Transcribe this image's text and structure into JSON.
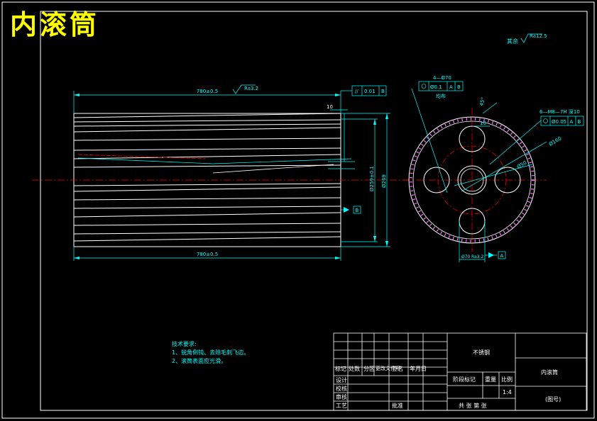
{
  "drawing": {
    "title": "内滚筒",
    "roughness_all": "其余",
    "roughness_all_value": "Ra12.5"
  },
  "front_view": {
    "overall_length_top": "780±0.5",
    "overall_length_bottom": "780±0.5",
    "roughness_top": "Ra3.2",
    "flatness_symbol": "//",
    "flatness_value": "0.01",
    "flatness_datum": "B",
    "dim_10": "10",
    "dim_15": "15",
    "dia_inner": "Ø259±0.1",
    "dia_outer": "Ø269",
    "datum_label": "B"
  },
  "side_view": {
    "holes_callout": "4—Ø70",
    "holes_tol": "Ø0.1",
    "holes_datum_a": "A",
    "holes_datum_b": "B",
    "holes_note": "均布",
    "slots_callout": "6—M8—7H 深10",
    "slots_tol": "Ø0.05",
    "slots_datum_a": "A",
    "slots_datum_b": "B",
    "pcd": "Ø160",
    "bore": "Ø50",
    "dim_45": "45°",
    "dim_10": "10",
    "bottom_dim": "Ø70",
    "bottom_roughness": "Ra3.2",
    "datum_label": "A"
  },
  "notes": {
    "heading": "技术要求:",
    "items": [
      "1、锐角倒钝、去除毛刺飞边。",
      "2、滚筒表面应光滑。"
    ]
  },
  "title_block": {
    "material": "不锈钢",
    "part_name": "内滚筒",
    "row_labels": [
      "标记",
      "处数",
      "分区",
      "更改文件号",
      "签名",
      "年月日"
    ],
    "design": "设计",
    "check": "校核",
    "review": "审核",
    "process": "工艺",
    "approve": "批准",
    "stage_mark": "阶段标记",
    "weight": "重量",
    "scale": "比例",
    "scale_value": "1:4",
    "sheet_info": "共 张  第 张",
    "code": "(图号)"
  }
}
